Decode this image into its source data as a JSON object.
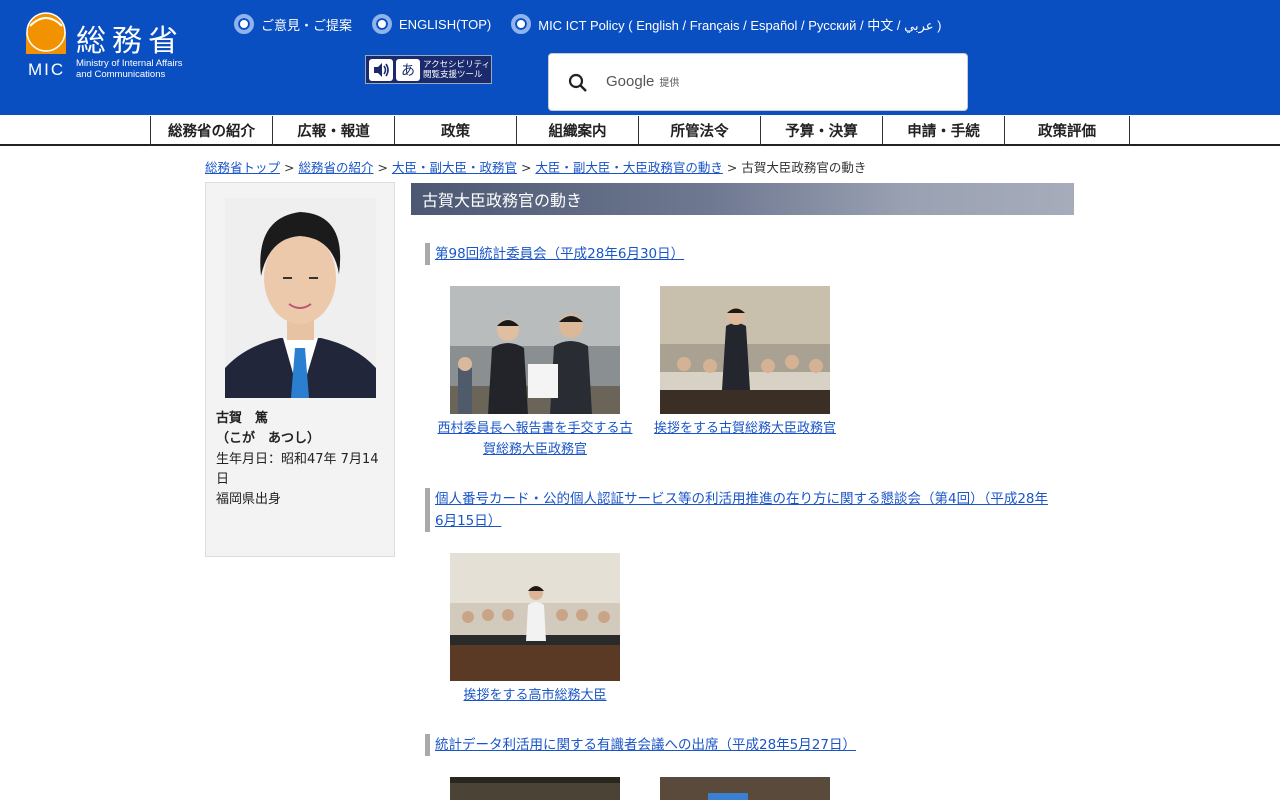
{
  "header": {
    "logo_jp": "総務省",
    "logo_mic": "MIC",
    "logo_en_line1": "Ministry of Internal Affairs",
    "logo_en_line2": "and Communications",
    "toplinks": [
      {
        "label": "ご意見・ご提案"
      },
      {
        "label": "ENGLISH(TOP)"
      },
      {
        "label": "MIC ICT Policy ( English / Français / Español / Русский / 中文 / عربي )"
      }
    ],
    "accessibility_text_line1": "アクセシビリティ",
    "accessibility_text_line2": "閲覧支援ツール",
    "accessibility_glyph": "あ",
    "search": {
      "brand": "Google",
      "provided": "提供",
      "value": ""
    }
  },
  "nav": {
    "items": [
      {
        "label": "総務省の紹介"
      },
      {
        "label": "広報・報道"
      },
      {
        "label": "政策"
      },
      {
        "label": "組織案内"
      },
      {
        "label": "所管法令"
      },
      {
        "label": "予算・決算"
      },
      {
        "label": "申請・手続"
      },
      {
        "label": "政策評価"
      }
    ]
  },
  "breadcrumb": {
    "items": [
      {
        "label": "総務省トップ"
      },
      {
        "label": "総務省の紹介"
      },
      {
        "label": "大臣・副大臣・政務官"
      },
      {
        "label": "大臣・副大臣・大臣政務官の動き"
      }
    ],
    "separator": ">",
    "current": "古賀大臣政務官の動き"
  },
  "sidebar": {
    "name": "古賀　篤",
    "reading": "（こが　あつし）",
    "birth": "生年月日：昭和47年 7月14日",
    "origin": "福岡県出身"
  },
  "main": {
    "title": "古賀大臣政務官の動き",
    "events": [
      {
        "title": "第98回統計委員会（平成28年6月30日）",
        "photos": [
          {
            "caption": "西村委員長へ報告書を手交する古賀総務大臣政務官"
          },
          {
            "caption": "挨拶をする古賀総務大臣政務官"
          }
        ]
      },
      {
        "title": "個人番号カード・公的個人認証サービス等の利活用推進の在り方に関する懇談会（第4回）（平成28年6月15日）",
        "photos": [
          {
            "caption": "挨拶をする高市総務大臣"
          }
        ]
      },
      {
        "title": "統計データ利活用に関する有識者会議への出席（平成28年5月27日）",
        "photos": []
      }
    ]
  },
  "colors": {
    "header_bg": "#0a4fc2",
    "link": "#1a55c8",
    "title_bar": "#4c5872",
    "logo_orange": "#f39200"
  }
}
